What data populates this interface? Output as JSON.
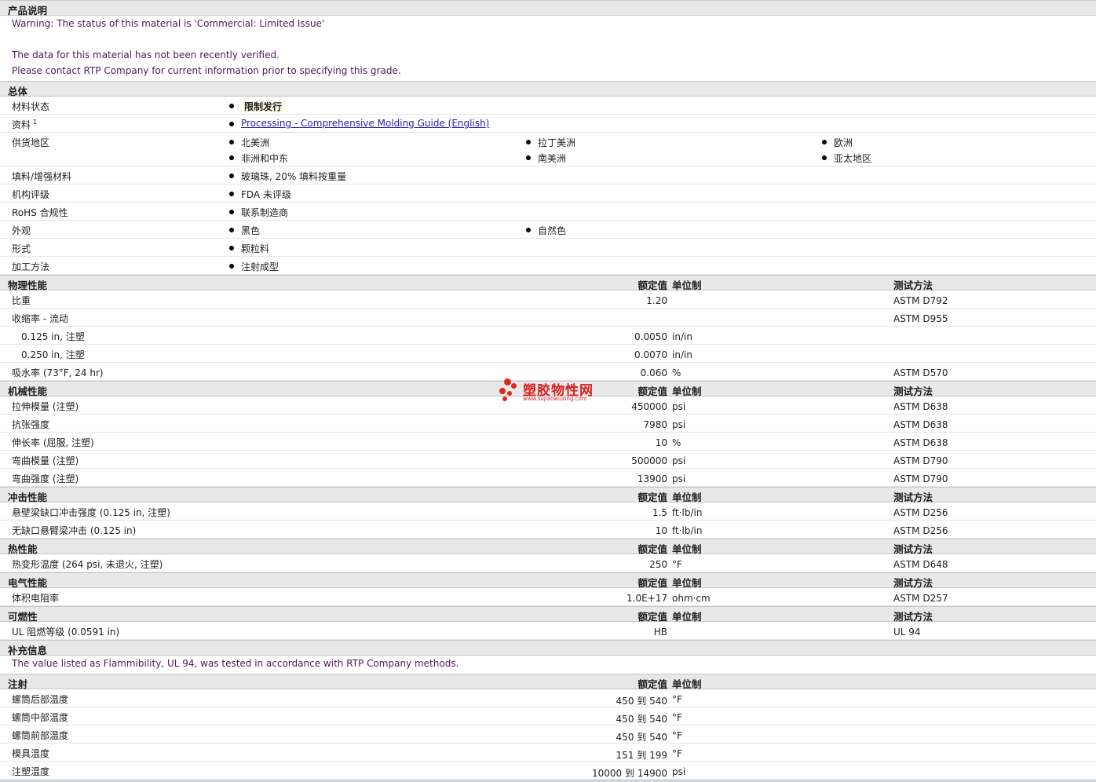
{
  "product_description": {
    "title": "产品说明",
    "lines": [
      "Warning: The status of this material is 'Commercial: Limited Issue'",
      "",
      "The data for this material has not been recently verified.",
      "Please contact RTP Company for current information prior to specifying this grade."
    ]
  },
  "general": {
    "title": "总体",
    "material_status": {
      "label": "材料状态",
      "value": "限制发行"
    },
    "literature": {
      "label": "资料",
      "sup": "1",
      "link": "Processing - Comprehensive Molding Guide (English)"
    },
    "availability": {
      "label": "供货地区",
      "regions": [
        "北美洲",
        "拉丁美洲",
        "欧洲",
        "非洲和中东",
        "南美洲",
        "亚太地区"
      ]
    },
    "filler": {
      "label": "填料/增强材料",
      "value": "玻璃珠, 20% 填料按重量"
    },
    "agency": {
      "label": "机构评级",
      "value": "FDA 未评级"
    },
    "rohs": {
      "label": "RoHS 合规性",
      "value": "联系制造商"
    },
    "appearance": {
      "label": "外观",
      "values": [
        "黑色",
        "自然色"
      ]
    },
    "forms": {
      "label": "形式",
      "value": "颗粒料"
    },
    "processing": {
      "label": "加工方法",
      "value": "注射成型"
    }
  },
  "col_headers": {
    "value": "额定值",
    "unit": "单位制",
    "method": "测试方法"
  },
  "physical": {
    "title": "物理性能",
    "rows": [
      {
        "label": "比重",
        "value": "1.20",
        "unit": "",
        "method": "ASTM D792"
      },
      {
        "label": "收缩率 - 流动",
        "value": "",
        "unit": "",
        "method": "ASTM D955"
      },
      {
        "label": "0.125 in, 注塑",
        "value": "0.0050",
        "unit": "in/in",
        "method": ""
      },
      {
        "label": "0.250 in, 注塑",
        "value": "0.0070",
        "unit": "in/in",
        "method": ""
      },
      {
        "label": "吸水率 (73°F, 24 hr)",
        "value": "0.060",
        "unit": "%",
        "method": "ASTM D570"
      }
    ]
  },
  "mechanical": {
    "title": "机械性能",
    "rows": [
      {
        "label": "拉伸模量 (注塑)",
        "value": "450000",
        "unit": "psi",
        "method": "ASTM D638"
      },
      {
        "label": "抗张强度",
        "value": "7980",
        "unit": "psi",
        "method": "ASTM D638"
      },
      {
        "label": "伸长率 (屈服, 注塑)",
        "value": "10",
        "unit": "%",
        "method": "ASTM D638"
      },
      {
        "label": "弯曲模量 (注塑)",
        "value": "500000",
        "unit": "psi",
        "method": "ASTM D790"
      },
      {
        "label": "弯曲强度 (注塑)",
        "value": "13900",
        "unit": "psi",
        "method": "ASTM D790"
      }
    ]
  },
  "impact": {
    "title": "冲击性能",
    "rows": [
      {
        "label": "悬壁梁缺口冲击强度 (0.125 in, 注塑)",
        "value": "1.5",
        "unit": "ft·lb/in",
        "method": "ASTM D256"
      },
      {
        "label": "无缺口悬臂梁冲击 (0.125 in)",
        "value": "10",
        "unit": "ft·lb/in",
        "method": "ASTM D256"
      }
    ]
  },
  "thermal": {
    "title": "热性能",
    "rows": [
      {
        "label": "热变形温度 (264 psi, 未退火, 注塑)",
        "value": "250",
        "unit": "°F",
        "method": "ASTM D648"
      }
    ]
  },
  "electrical": {
    "title": "电气性能",
    "rows": [
      {
        "label": "体积电阻率",
        "value": "1.0E+17",
        "unit": "ohm·cm",
        "method": "ASTM D257"
      }
    ]
  },
  "flammability": {
    "title": "可燃性",
    "rows": [
      {
        "label": "UL 阻燃等级 (0.0591 in)",
        "value": "HB",
        "unit": "",
        "method": "UL 94"
      }
    ]
  },
  "supplemental": {
    "title": "补充信息",
    "text": "The value listed as Flammibility, UL 94, was tested in accordance with RTP Company methods."
  },
  "injection": {
    "title": "注射",
    "rows": [
      {
        "label": "螺筒后部温度",
        "value": "450 到 540",
        "unit": "°F"
      },
      {
        "label": "螺筒中部温度",
        "value": "450 到 540",
        "unit": "°F"
      },
      {
        "label": "螺筒前部温度",
        "value": "450 到 540",
        "unit": "°F"
      },
      {
        "label": "模具温度",
        "value": "151 到 199",
        "unit": "°F"
      },
      {
        "label": "注塑温度",
        "value": "10000 到 14900",
        "unit": "psi"
      }
    ]
  },
  "watermark": {
    "title": "塑胶物性网",
    "url": "www.sujiaowuxing.com",
    "colors": {
      "red": "#e0251a"
    }
  }
}
